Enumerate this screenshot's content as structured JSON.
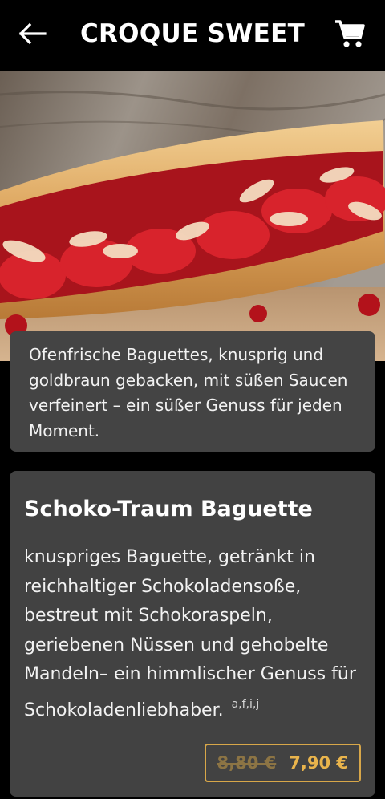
{
  "header": {
    "title": "CROQUE SWEET",
    "back_icon": "arrow-left-icon",
    "cart_icon": "shopping-cart-icon"
  },
  "category": {
    "description": "Ofenfrische Baguettes, knusprig und goldbraun gebacken, mit süßen Saucen verfeinert – ein süßer Genuss für jeden Moment."
  },
  "product": {
    "name": "Schoko-Traum Baguette",
    "description": "knuspriges Baguette, getränkt in reichhaltiger Schokoladensoße, bestreut mit Schokoraspeln, geriebenen Nüssen und gehobelte Mandeln– ein himmlischer Genuss für Schokoladenliebhaber.",
    "allergens": "a,f,i,j",
    "old_price": "8,80 €",
    "price": "7,90 €"
  },
  "colors": {
    "background": "#000000",
    "card": "#444444",
    "accent": "#e9b44c"
  }
}
